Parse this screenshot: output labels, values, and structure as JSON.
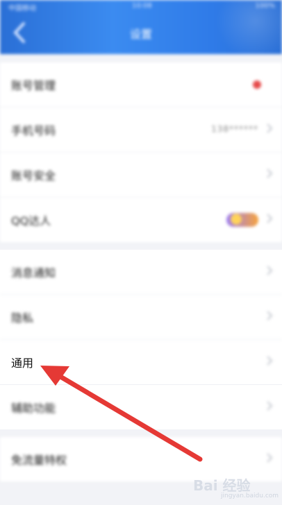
{
  "status_bar": {
    "left": "中国移动",
    "center": "10:08",
    "right": "100%"
  },
  "header": {
    "title": "设置",
    "back_icon": "chevron-left-icon"
  },
  "section1": [
    {
      "label": "账号管理",
      "indicator": "red-dot"
    },
    {
      "label": "手机号码",
      "value": "138******"
    },
    {
      "label": "账号安全"
    },
    {
      "label": "QQ达人",
      "indicator": "qq-badge"
    }
  ],
  "section2": [
    {
      "label": "消息通知"
    },
    {
      "label": "隐私"
    },
    {
      "label": "通用"
    },
    {
      "label": "辅助功能"
    }
  ],
  "section3": [
    {
      "label": "免流量特权"
    }
  ],
  "annotation": {
    "arrow_color": "#e53935"
  },
  "watermark": {
    "text": "Bai 经验",
    "sub": "jingyan.baidu.com"
  },
  "colors": {
    "header": "#2f7be8",
    "background": "#f2f3f7",
    "red_dot": "#e64b4b"
  }
}
